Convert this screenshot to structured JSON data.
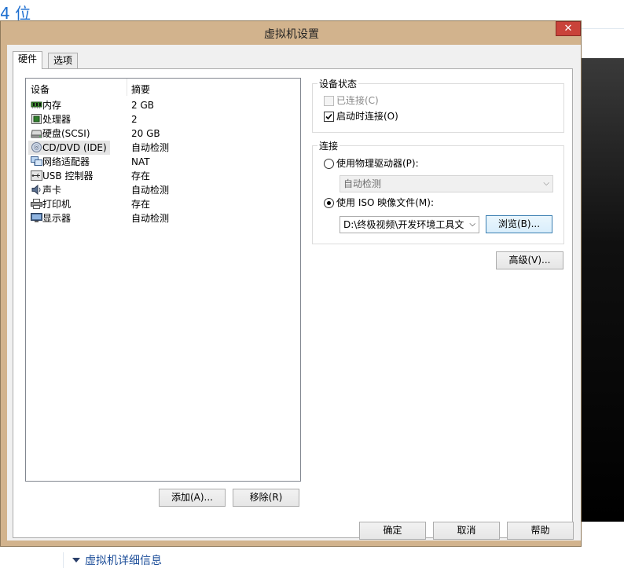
{
  "background": {
    "heading_text": "4 位",
    "bottom_link": "虚拟机详细信息"
  },
  "window": {
    "title": "虚拟机设置",
    "close_label": "✕"
  },
  "tabs": [
    {
      "label": "硬件",
      "active": true
    },
    {
      "label": "选项",
      "active": false
    }
  ],
  "device_list": {
    "columns": [
      "设备",
      "摘要"
    ],
    "rows": [
      {
        "name": "内存",
        "summary": "2 GB",
        "icon": "memory-icon"
      },
      {
        "name": "处理器",
        "summary": "2",
        "icon": "processor-icon"
      },
      {
        "name": "硬盘(SCSI)",
        "summary": "20 GB",
        "icon": "hard-disk-icon"
      },
      {
        "name": "CD/DVD (IDE)",
        "summary": "自动检测",
        "icon": "cd-dvd-icon",
        "selected": true
      },
      {
        "name": "网络适配器",
        "summary": "NAT",
        "icon": "network-adapter-icon"
      },
      {
        "name": "USB 控制器",
        "summary": "存在",
        "icon": "usb-icon"
      },
      {
        "name": "声卡",
        "summary": "自动检测",
        "icon": "sound-card-icon"
      },
      {
        "name": "打印机",
        "summary": "存在",
        "icon": "printer-icon"
      },
      {
        "name": "显示器",
        "summary": "自动检测",
        "icon": "display-icon"
      }
    ],
    "add_label": "添加(A)...",
    "remove_label": "移除(R)"
  },
  "device_status": {
    "group_label": "设备状态",
    "connected_label": "已连接(C)",
    "connected_checked": false,
    "connected_enabled": false,
    "connect_at_power_on_label": "启动时连接(O)",
    "connect_at_power_on_checked": true
  },
  "connection": {
    "group_label": "连接",
    "physical_drive_label": "使用物理驱动器(P):",
    "physical_drive_selected": false,
    "physical_drive_value": "自动检测",
    "iso_label": "使用 ISO 映像文件(M):",
    "iso_selected": true,
    "iso_path": "D:\\终极视频\\开发环境工具文",
    "browse_label": "浏览(B)..."
  },
  "advanced_label": "高级(V)...",
  "footer": {
    "ok_label": "确定",
    "cancel_label": "取消",
    "help_label": "帮助"
  },
  "colors": {
    "frame": "#d2b38d",
    "close_button": "#c9433a",
    "selection": "#e5e5e5"
  }
}
